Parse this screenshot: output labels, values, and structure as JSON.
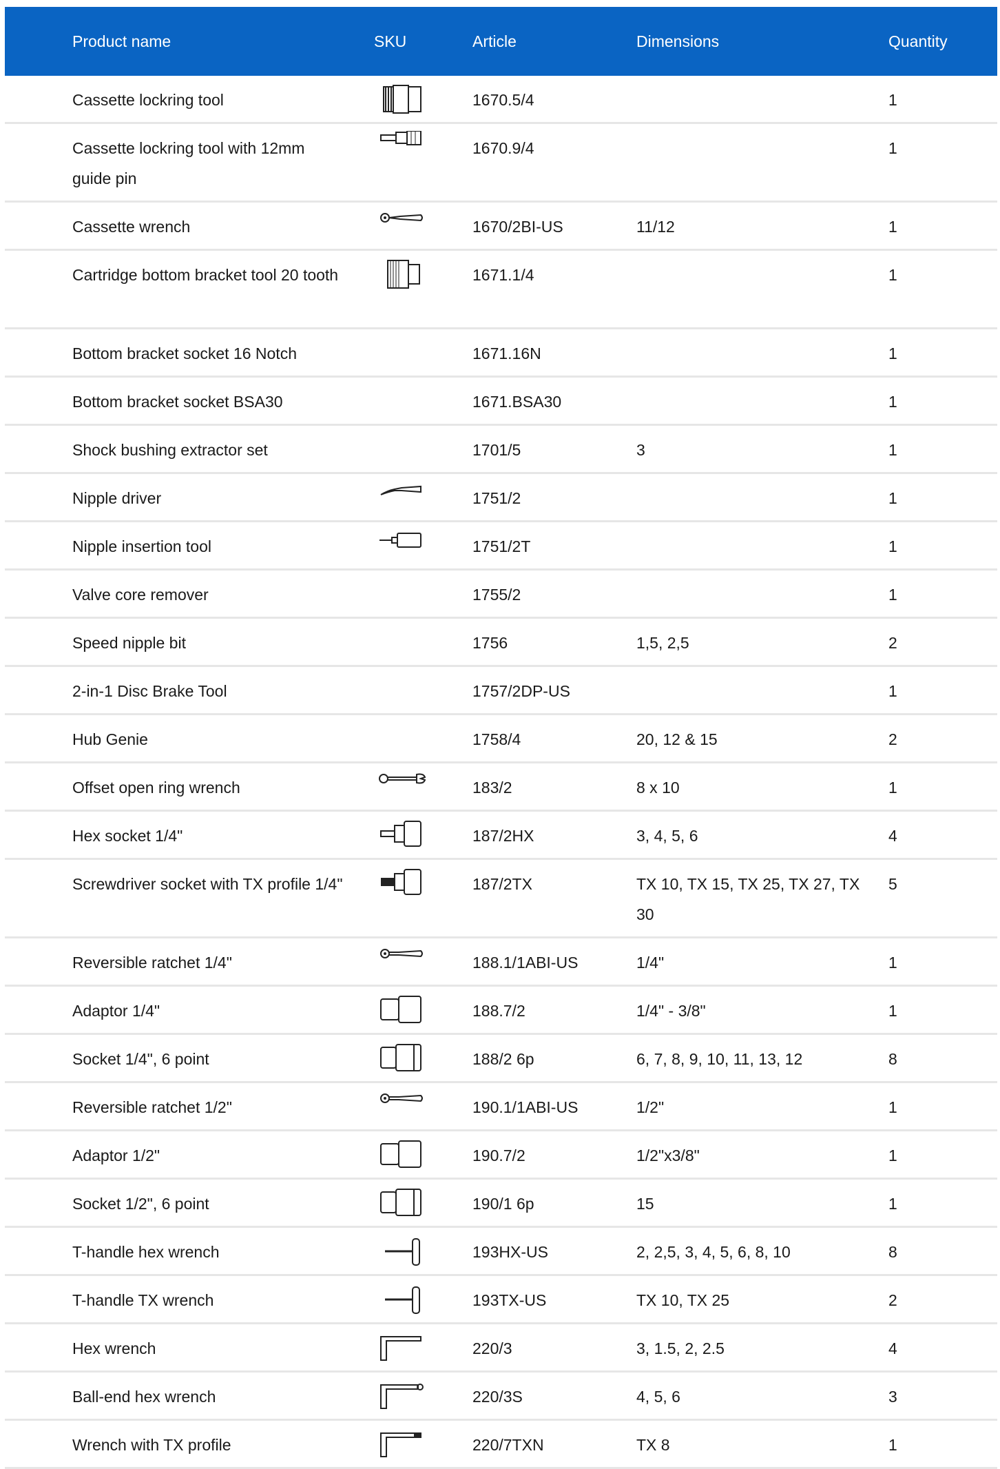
{
  "header": {
    "product_name": "Product name",
    "sku": "SKU",
    "article": "Article",
    "dimensions": "Dimensions",
    "quantity": "Quantity"
  },
  "colors": {
    "header_bg": "#0a64c3",
    "row_divider": "#e6e6e6"
  },
  "rows": [
    {
      "name": "Cassette lockring tool",
      "article": "1670.5/4",
      "dimensions": "",
      "quantity": "1",
      "icon": "lockring-tool-icon",
      "lines": 1
    },
    {
      "name": "Cassette lockring tool with 12mm guide pin",
      "article": "1670.9/4",
      "dimensions": "",
      "quantity": "1",
      "icon": "lockring-pin-tool-icon",
      "lines": 2
    },
    {
      "name": "Cassette wrench",
      "article": "1670/2BI-US",
      "dimensions": "11/12",
      "quantity": "1",
      "icon": "cassette-wrench-icon",
      "lines": 1
    },
    {
      "name": "Cartridge bottom bracket tool 20 tooth",
      "article": "1671.1/4",
      "dimensions": "",
      "quantity": "1",
      "icon": "bottom-bracket-tool-icon",
      "lines": 2
    },
    {
      "name": "Bottom bracket socket 16 Notch",
      "article": "1671.16N",
      "dimensions": "",
      "quantity": "1",
      "icon": "",
      "lines": 1
    },
    {
      "name": "Bottom bracket socket BSA30",
      "article": "1671.BSA30",
      "dimensions": "",
      "quantity": "1",
      "icon": "",
      "lines": 1
    },
    {
      "name": "Shock bushing extractor set",
      "article": "1701/5",
      "dimensions": "3",
      "quantity": "1",
      "icon": "",
      "lines": 1
    },
    {
      "name": "Nipple driver",
      "article": "1751/2",
      "dimensions": "",
      "quantity": "1",
      "icon": "nipple-driver-icon",
      "lines": 1
    },
    {
      "name": "Nipple insertion tool",
      "article": "1751/2T",
      "dimensions": "",
      "quantity": "1",
      "icon": "nipple-insertion-tool-icon",
      "lines": 1
    },
    {
      "name": "Valve core remover",
      "article": "1755/2",
      "dimensions": "",
      "quantity": "1",
      "icon": "",
      "lines": 1
    },
    {
      "name": "Speed nipple bit",
      "article": "1756",
      "dimensions": "1,5, 2,5",
      "quantity": "2",
      "icon": "",
      "lines": 1
    },
    {
      "name": "2-in-1 Disc Brake Tool",
      "article": "1757/2DP-US",
      "dimensions": "",
      "quantity": "1",
      "icon": "",
      "lines": 1
    },
    {
      "name": "Hub Genie",
      "article": "1758/4",
      "dimensions": "20, 12 & 15",
      "quantity": "2",
      "icon": "",
      "lines": 1
    },
    {
      "name": "Offset open ring wrench",
      "article": "183/2",
      "dimensions": "8 x 10",
      "quantity": "1",
      "icon": "open-ring-wrench-icon",
      "lines": 1
    },
    {
      "name": "Hex socket 1/4\"",
      "article": "187/2HX",
      "dimensions": "3, 4, 5, 6",
      "quantity": "4",
      "icon": "hex-socket-icon",
      "lines": 1
    },
    {
      "name": "Screwdriver socket with TX profile 1/4\"",
      "article": "187/2TX",
      "dimensions": "TX 10, TX 15, TX 25, TX 27, TX 30",
      "quantity": "5",
      "icon": "tx-socket-icon",
      "lines": 2
    },
    {
      "name": "Reversible ratchet 1/4\"",
      "article": "188.1/1ABI-US",
      "dimensions": "1/4\"",
      "quantity": "1",
      "icon": "ratchet-icon",
      "lines": 1
    },
    {
      "name": "Adaptor 1/4\"",
      "article": "188.7/2",
      "dimensions": "1/4\" - 3/8\"",
      "quantity": "1",
      "icon": "adaptor-icon",
      "lines": 1
    },
    {
      "name": "Socket 1/4\", 6 point",
      "article": "188/2 6p",
      "dimensions": "6, 7, 8, 9, 10, 11, 13, 12",
      "quantity": "8",
      "icon": "socket-icon",
      "lines": 1
    },
    {
      "name": "Reversible ratchet 1/2\"",
      "article": "190.1/1ABI-US",
      "dimensions": "1/2\"",
      "quantity": "1",
      "icon": "ratchet-icon",
      "lines": 1
    },
    {
      "name": "Adaptor 1/2\"",
      "article": "190.7/2",
      "dimensions": "1/2\"x3/8\"",
      "quantity": "1",
      "icon": "adaptor-icon",
      "lines": 1
    },
    {
      "name": "Socket 1/2\", 6 point",
      "article": "190/1 6p",
      "dimensions": "15",
      "quantity": "1",
      "icon": "socket-icon",
      "lines": 1
    },
    {
      "name": "T-handle hex wrench",
      "article": "193HX-US",
      "dimensions": "2, 2,5, 3, 4, 5, 6, 8, 10",
      "quantity": "8",
      "icon": "t-handle-hex-icon",
      "lines": 1
    },
    {
      "name": "T-handle TX wrench",
      "article": "193TX-US",
      "dimensions": "TX 10, TX 25",
      "quantity": "2",
      "icon": "t-handle-tx-icon",
      "lines": 1
    },
    {
      "name": "Hex wrench",
      "article": "220/3",
      "dimensions": "3, 1.5, 2, 2.5",
      "quantity": "4",
      "icon": "hex-key-icon",
      "lines": 1
    },
    {
      "name": "Ball-end hex wrench",
      "article": "220/3S",
      "dimensions": "4, 5, 6",
      "quantity": "3",
      "icon": "ball-end-hex-key-icon",
      "lines": 1
    },
    {
      "name": "Wrench with TX profile",
      "article": "220/7TXN",
      "dimensions": "TX 8",
      "quantity": "1",
      "icon": "tx-key-icon",
      "lines": 1
    }
  ]
}
